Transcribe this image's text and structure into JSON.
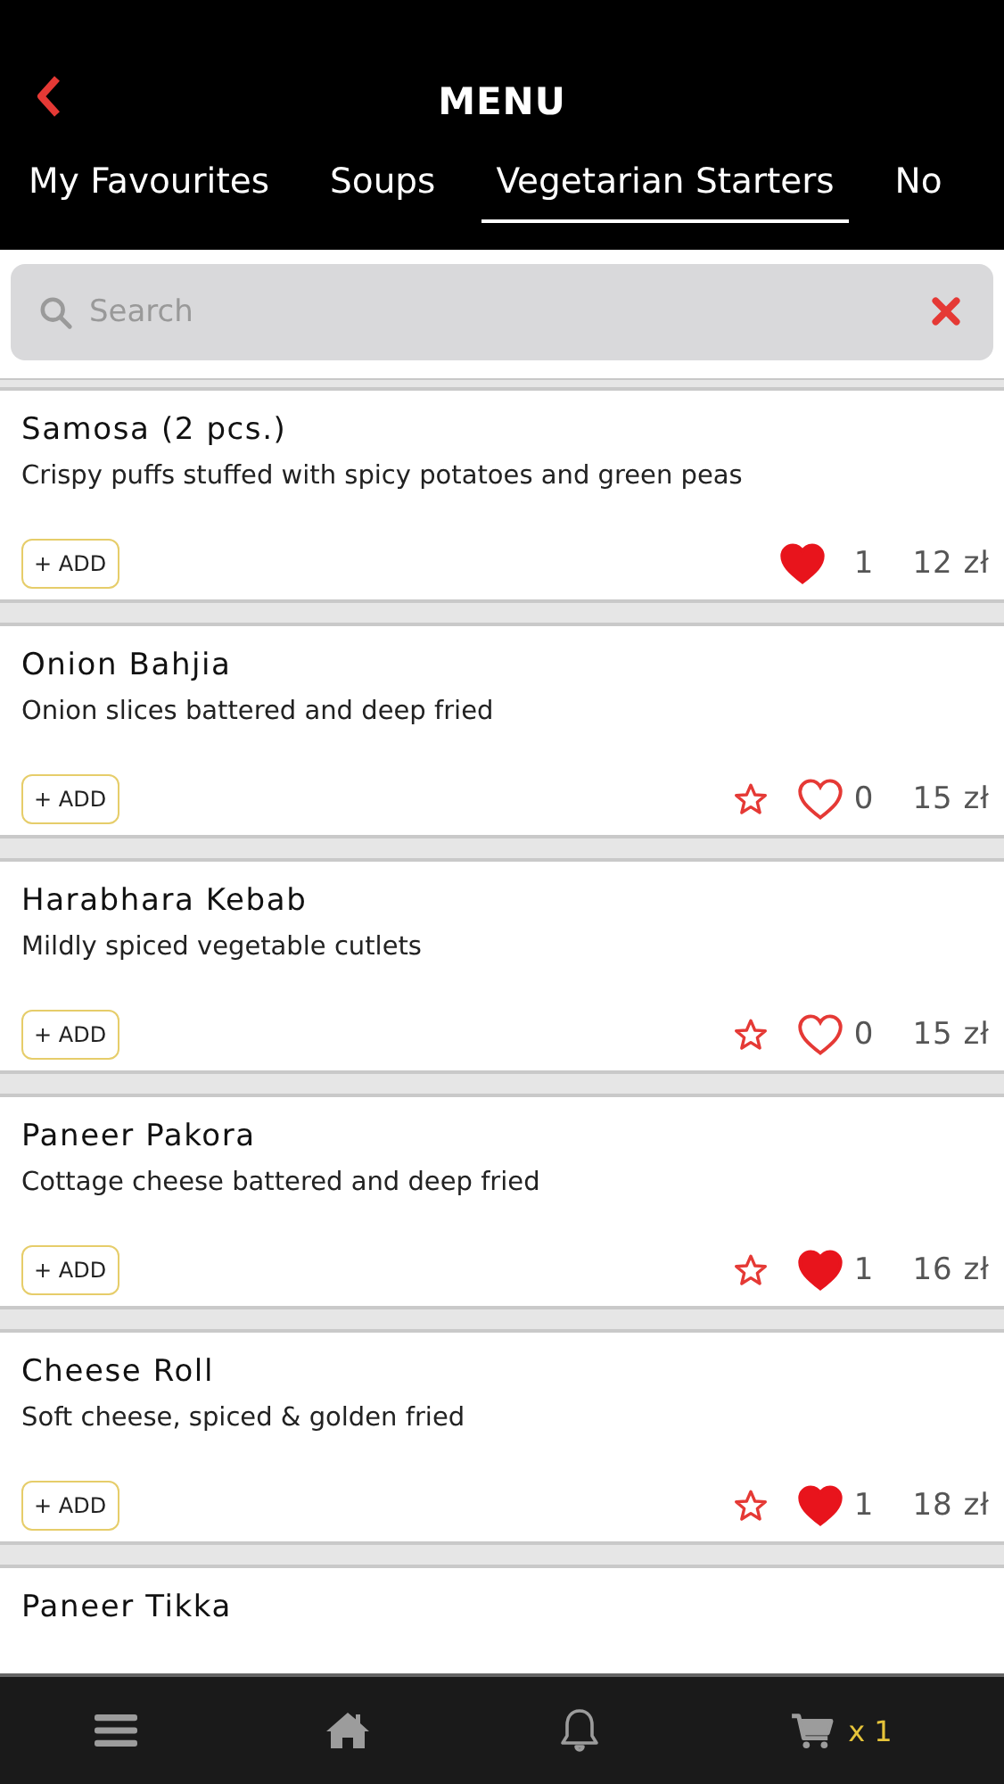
{
  "header": {
    "title": "MENU"
  },
  "tabs": [
    {
      "label": "My Favourites",
      "selected": false
    },
    {
      "label": "Soups",
      "selected": false
    },
    {
      "label": "Vegetarian Starters",
      "selected": true
    },
    {
      "label": "No",
      "selected": false
    }
  ],
  "search": {
    "placeholder": "Search"
  },
  "items": [
    {
      "name": "Samosa (2 pcs.)",
      "description": "Crispy puffs stuffed with spicy potatoes and green peas",
      "add": "+ ADD",
      "star": false,
      "liked": true,
      "likes": "1",
      "price": "12 zł"
    },
    {
      "name": "Onion Bahjia",
      "description": "Onion slices battered and deep fried",
      "add": "+ ADD",
      "star": true,
      "liked": false,
      "likes": "0",
      "price": "15 zł"
    },
    {
      "name": "Harabhara Kebab",
      "description": "Mildly spiced vegetable cutlets",
      "add": "+ ADD",
      "star": true,
      "liked": false,
      "likes": "0",
      "price": "15 zł"
    },
    {
      "name": "Paneer Pakora",
      "description": "Cottage cheese battered and deep fried",
      "add": "+ ADD",
      "star": true,
      "liked": true,
      "likes": "1",
      "price": "16 zł"
    },
    {
      "name": "Cheese Roll",
      "description": "Soft cheese, spiced & golden fried",
      "add": "+ ADD",
      "star": true,
      "liked": true,
      "likes": "1",
      "price": "18 zł"
    },
    {
      "name": "Paneer Tikka"
    }
  ],
  "bottom_bar": {
    "cart_count": "x 1"
  }
}
